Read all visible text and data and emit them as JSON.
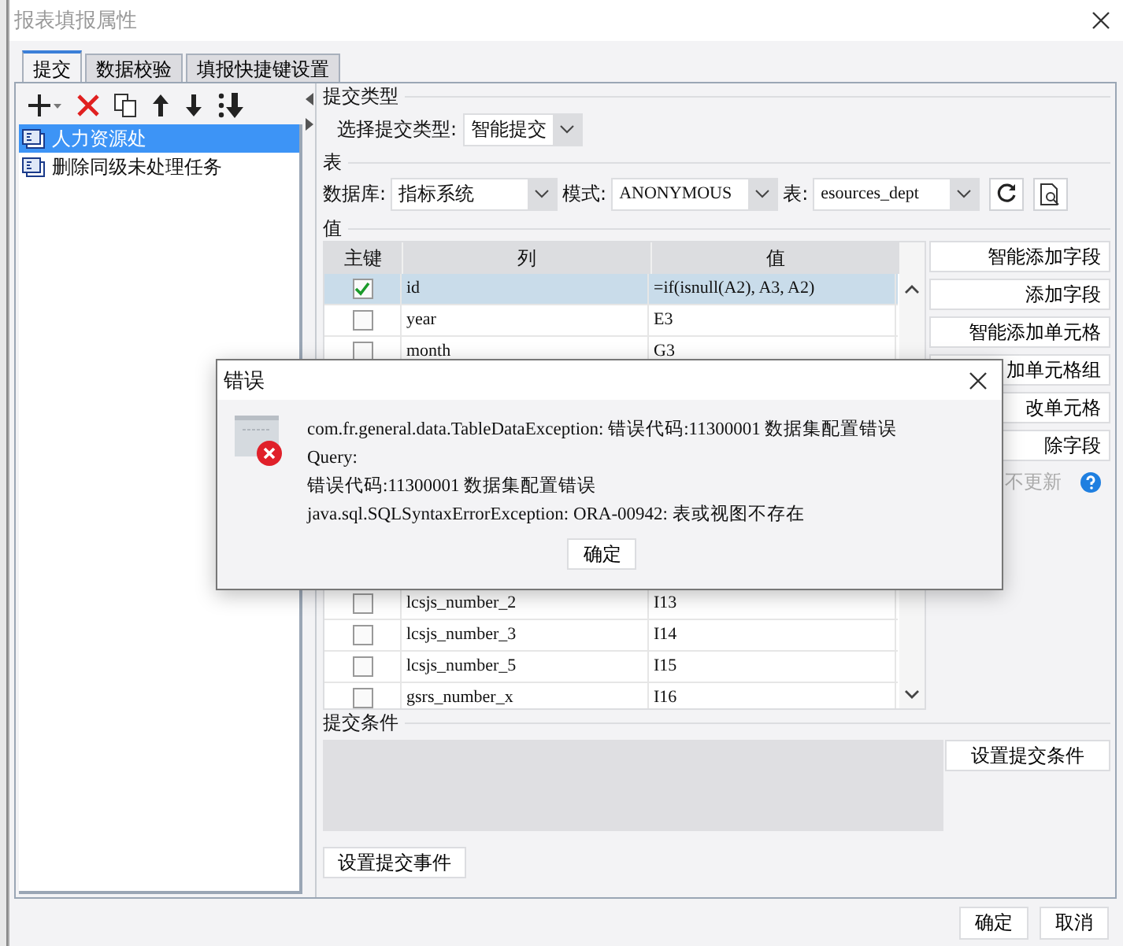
{
  "window": {
    "title": "报表填报属性"
  },
  "tabs": [
    {
      "label": "提交",
      "selected": true
    },
    {
      "label": "数据校验",
      "selected": false
    },
    {
      "label": "填报快捷键设置",
      "selected": false
    }
  ],
  "items": [
    {
      "label": "人力资源处",
      "selected": true
    },
    {
      "label": "删除同级未处理任务",
      "selected": false
    }
  ],
  "submit_type": {
    "heading": "提交类型",
    "label": "选择提交类型:",
    "value": "智能提交"
  },
  "table_section": {
    "heading": "表",
    "database_label": "数据库:",
    "database": "指标系统",
    "schema_label": "模式:",
    "schema": "ANONYMOUS",
    "table_label": "表:",
    "table": "esources_dept"
  },
  "values": {
    "heading": "值",
    "columns": [
      "主键",
      "列",
      "值"
    ],
    "rows_top": [
      {
        "primary_key": true,
        "column": "id",
        "value": "=if(isnull(A2), A3, A2)",
        "selected": true
      },
      {
        "primary_key": false,
        "column": "year",
        "value": "E3",
        "selected": false
      },
      {
        "primary_key": false,
        "column": "month",
        "value": "G3",
        "selected": false
      }
    ],
    "rows_bottom": [
      {
        "primary_key": false,
        "column": "lcsjs_number_2",
        "value": "I13",
        "selected": false
      },
      {
        "primary_key": false,
        "column": "lcsjs_number_3",
        "value": "I14",
        "selected": false
      },
      {
        "primary_key": false,
        "column": "lcsjs_number_5",
        "value": "I15",
        "selected": false
      },
      {
        "primary_key": false,
        "column": "gsrs_number_x",
        "value": "I16",
        "selected": false
      }
    ]
  },
  "side_buttons": [
    "智能添加字段",
    "添加字段",
    "智能添加单元格",
    "加单元格组",
    "改单元格",
    "除字段"
  ],
  "no_update_label": "不更新",
  "condition": {
    "heading": "提交条件",
    "button": "设置提交条件"
  },
  "event_button": "设置提交事件",
  "footer_buttons": [
    "确定",
    "取消"
  ],
  "error_dialog": {
    "title": "错误",
    "lines": [
      "com.fr.general.data.TableDataException: 错误代码:11300001 数据集配置错误",
      "Query:",
      "错误代码:11300001 数据集配置错误",
      "java.sql.SQLSyntaxErrorException: ORA-00942: 表或视图不存在"
    ],
    "button": "确定"
  }
}
